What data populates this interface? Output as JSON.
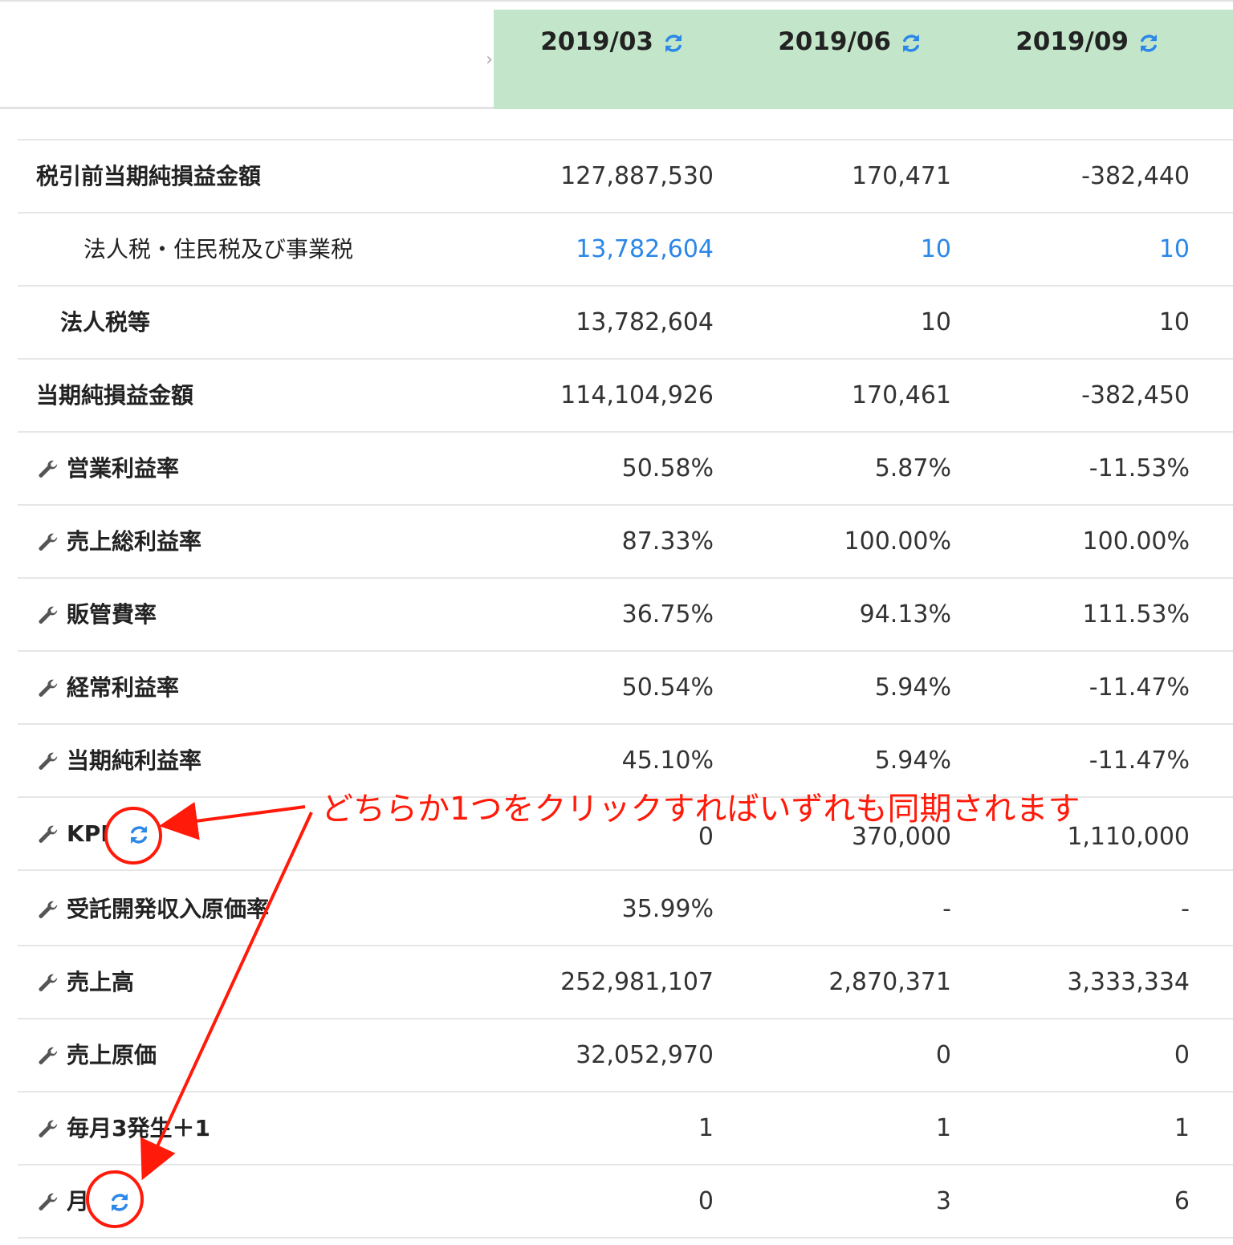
{
  "header": {
    "periods": [
      "2019/03",
      "2019/06",
      "2019/09"
    ]
  },
  "rows": [
    {
      "label": "税引前当期純損益金額",
      "values": [
        "127,887,530",
        "170,471",
        "-382,440"
      ]
    },
    {
      "label": "法人税・住民税及び事業税",
      "values": [
        "13,782,604",
        "10",
        "10"
      ]
    },
    {
      "label": "法人税等",
      "values": [
        "13,782,604",
        "10",
        "10"
      ]
    },
    {
      "label": "当期純損益金額",
      "values": [
        "114,104,926",
        "170,461",
        "-382,450"
      ]
    },
    {
      "label": "営業利益率",
      "values": [
        "50.58%",
        "5.87%",
        "-11.53%"
      ]
    },
    {
      "label": "売上総利益率",
      "values": [
        "87.33%",
        "100.00%",
        "100.00%"
      ]
    },
    {
      "label": "販管費率",
      "values": [
        "36.75%",
        "94.13%",
        "111.53%"
      ]
    },
    {
      "label": "経常利益率",
      "values": [
        "50.54%",
        "5.94%",
        "-11.47%"
      ]
    },
    {
      "label": "当期純利益率",
      "values": [
        "45.10%",
        "5.94%",
        "-11.47%"
      ]
    },
    {
      "label": "KPI",
      "values": [
        "0",
        "370,000",
        "1,110,000"
      ]
    },
    {
      "label": "受託開発収入原価率",
      "values": [
        "35.99%",
        "-",
        "-"
      ]
    },
    {
      "label": "売上高",
      "values": [
        "252,981,107",
        "2,870,371",
        "3,333,334"
      ]
    },
    {
      "label": "売上原価",
      "values": [
        "32,052,970",
        "0",
        "0"
      ]
    },
    {
      "label": "毎月3発生＋1",
      "values": [
        "1",
        "1",
        "1"
      ]
    },
    {
      "label": "月",
      "values": [
        "0",
        "3",
        "6"
      ]
    }
  ],
  "annotation": {
    "text": "どちらか1つをクリックすればいずれも同期されます",
    "color": "#ff1a0a"
  },
  "colors": {
    "header_band": "#c3e6cb",
    "link": "#2b87e8",
    "sync_icon": "#2b87e8"
  },
  "icons": [
    "sync-icon",
    "wrench-icon",
    "chevron-right-icon"
  ]
}
